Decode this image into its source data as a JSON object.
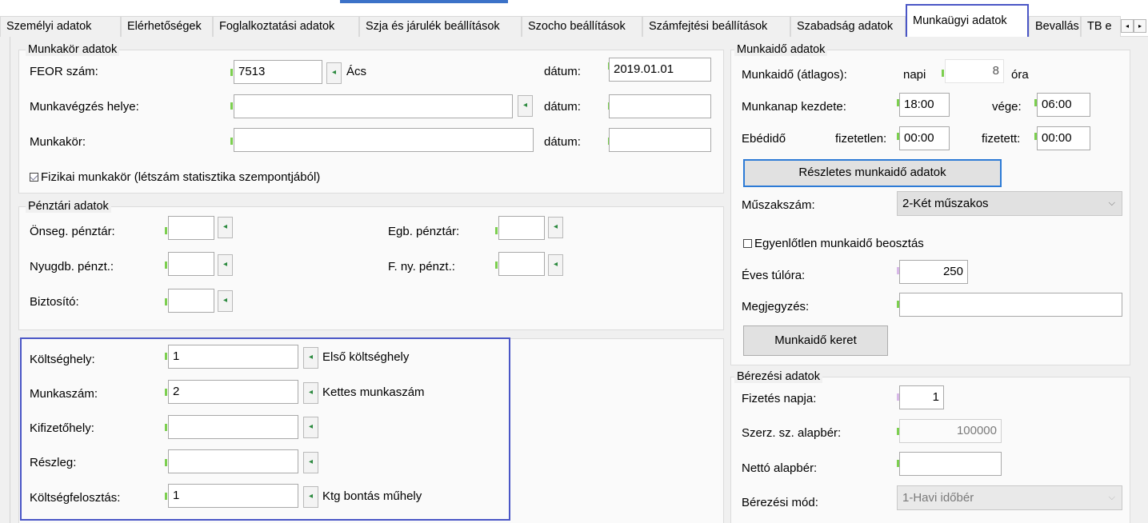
{
  "tabs": [
    {
      "label": "Személyi adatok"
    },
    {
      "label": "Elérhetőségek"
    },
    {
      "label": "Foglalkoztatási adatok"
    },
    {
      "label": "Szja és járulék beállítások"
    },
    {
      "label": "Szocho beállítások"
    },
    {
      "label": "Számfejtési beállítások"
    },
    {
      "label": "Szabadság adatok"
    },
    {
      "label": "Munkaügyi adatok"
    },
    {
      "label": "Bevallás"
    },
    {
      "label": "TB e"
    }
  ],
  "tab_nav": {
    "prev": "◂",
    "next": "▸"
  },
  "munkakor": {
    "title": "Munkakör adatok",
    "feor_label": "FEOR szám:",
    "feor_value": "7513",
    "feor_name": "Ács",
    "date_label": "dátum:",
    "feor_date": "2019.01.01",
    "hely_label": "Munkavégzés helye:",
    "hely_value": "",
    "hely_date": "",
    "munkakor_label": "Munkakör:",
    "munkakor_value": "",
    "munkakor_date": "",
    "fizikai_label": "Fizikai munkakör (létszám statisztika szempontjából)",
    "fizikai_checked": true
  },
  "penztar": {
    "title": "Pénztári adatok",
    "onseg_label": "Önseg. pénztár:",
    "onseg_value": "",
    "egb_label": "Egb. pénztár:",
    "egb_value": "",
    "nyugdb_label": "Nyugdb. pénzt.:",
    "nyugdb_value": "",
    "fny_label": "F. ny. pénzt.:",
    "fny_value": "",
    "biztosito_label": "Biztosító:",
    "biztosito_value": ""
  },
  "koltseg": {
    "koltseghely_label": "Költséghely:",
    "koltseghely_value": "1",
    "koltseghely_name": "Első költséghely",
    "munkaszam_label": "Munkaszám:",
    "munkaszam_value": "2",
    "munkaszam_name": "Kettes munkaszám",
    "kifizetohely_label": "Kifizetőhely:",
    "kifizetohely_value": "",
    "reszleg_label": "Részleg:",
    "reszleg_value": "",
    "felosztas_label": "Költségfelosztás:",
    "felosztas_value": "1",
    "felosztas_name": "Ktg bontás műhely"
  },
  "munkaido": {
    "title": "Munkaidő adatok",
    "atlag_label": "Munkaidő (átlagos):",
    "napi_label": "napi",
    "napi_value": "8",
    "ora_label": "óra",
    "kezdete_label": "Munkanap kezdete:",
    "kezdete_value": "18:00",
    "vege_label": "vége:",
    "vege_value": "06:00",
    "ebedido_label": "Ebédidő",
    "fizetetlen_label": "fizetetlen:",
    "fizetetlen_value": "00:00",
    "fizetett_label": "fizetett:",
    "fizetett_value": "00:00",
    "reszletes_button": "Részletes munkaidő adatok",
    "muszakszam_label": "Műszakszám:",
    "muszakszam_value": "2-Két műszakos",
    "egyenlotlen_label": "Egyenlőtlen munkaidő beosztás",
    "egyenlotlen_checked": false,
    "tulora_label": "Éves túlóra:",
    "tulora_value": "250",
    "megjegyzes_label": "Megjegyzés:",
    "megjegyzes_value": "",
    "keret_button": "Munkaidő keret"
  },
  "berezesi": {
    "title": "Bérezési adatok",
    "fizetes_label": "Fizetés napja:",
    "fizetes_value": "1",
    "alapber_label": "Szerz. sz. alapbér:",
    "alapber_value": "100000",
    "netto_label": "Nettó alapbér:",
    "netto_value": "",
    "mod_label": "Bérezési mód:",
    "mod_value": "1-Havi időbér"
  },
  "icons": {
    "lookup": "◂",
    "dropdown": "⌵"
  },
  "colors": {
    "highlight": "#4a56c6",
    "marker": "#7ccf4f",
    "accent": "#3c72c8"
  }
}
